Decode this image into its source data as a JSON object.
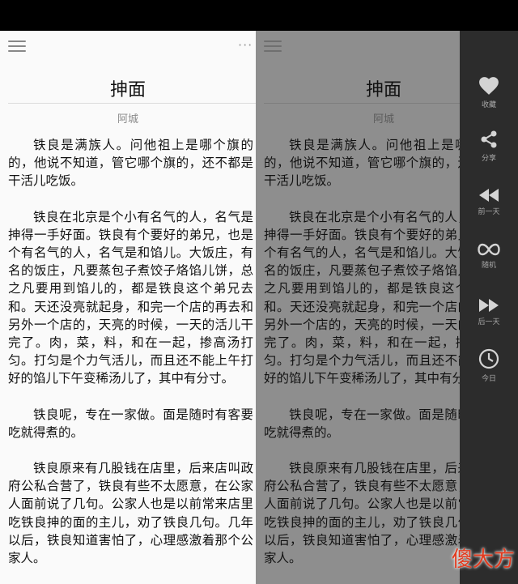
{
  "article": {
    "title": "抻面",
    "author": "阿城",
    "paragraphs": [
      "铁良是满族人。问他祖上是哪个旗的的，他说不知道，管它哪个旗的，还不都是干活儿吃饭。",
      "铁良在北京是个小有名气的人，名气是抻得一手好面。铁良有个要好的弟兄，也是个有名气的人，名气是和馅儿。大饭庄，有名的饭庄，凡要蒸包子煮饺子烙馅儿饼，总之凡要用到馅儿的，都是铁良这个弟兄去和。天还没亮就起身，和完一个店的再去和另外一个店的，天亮的时候，一天的活儿干完了。肉，菜，料，和在一起，掺高汤打匀。打匀是个力气活儿，而且还不能上午打好的馅儿下午变稀汤儿了，其中有分寸。",
      "铁良呢，专在一家做。面是随时有客要吃就得煮的。",
      "铁良原来有几股钱在店里，后来店叫政府公私合营了，铁良有些不太愿意，在公家人面前说了几句。公家人也是以前常来店里吃铁良抻的面的主儿，劝了铁良几句。几年以后，铁良知道害怕了，心理感激着那个公家人。"
    ]
  },
  "toolbar": {
    "more": "···"
  },
  "side_menu": [
    {
      "label": "收藏",
      "icon": "heart-icon"
    },
    {
      "label": "分享",
      "icon": "share-icon"
    },
    {
      "label": "前一天",
      "icon": "rewind-icon"
    },
    {
      "label": "随机",
      "icon": "infinity-icon"
    },
    {
      "label": "后一天",
      "icon": "fast-forward-icon"
    },
    {
      "label": "今日",
      "icon": "clock-icon"
    }
  ],
  "watermark": "傻大方",
  "colors": {
    "side_panel_bg": "#2c2c2c",
    "overlay_bg": "#8e8e8e",
    "watermark": "#e23b1f"
  }
}
